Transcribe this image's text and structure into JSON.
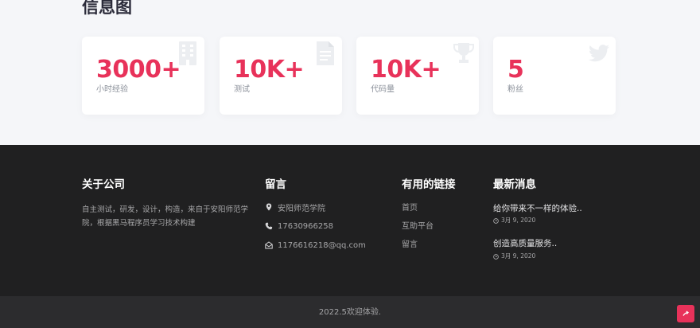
{
  "section": {
    "title": "信息图"
  },
  "stats": [
    {
      "value": "3000+",
      "label": "小时经验",
      "icon": "building-icon"
    },
    {
      "value": "10K+",
      "label": "测试",
      "icon": "document-icon"
    },
    {
      "value": "10K+",
      "label": "代码量",
      "icon": "trophy-icon"
    },
    {
      "value": "5",
      "label": "粉丝",
      "icon": "twitter-icon"
    }
  ],
  "footer": {
    "about": {
      "title": "关于公司",
      "text": "自主测试，研发，设计，构造，来自于安阳师范学院，根据黑马程序员学习技术构建"
    },
    "contact": {
      "title": "留言",
      "items": [
        {
          "icon": "map-marker-icon",
          "text": "安阳师范学院"
        },
        {
          "icon": "phone-icon",
          "text": "17630966258"
        },
        {
          "icon": "envelope-icon",
          "text": "1176616218@qq.com"
        }
      ]
    },
    "links": {
      "title": "有用的链接",
      "items": [
        "首页",
        "互助平台",
        "留言"
      ]
    },
    "news": {
      "title": "最新消息",
      "items": [
        {
          "title": "给你带来不一样的体验..",
          "date": "3月 9, 2020"
        },
        {
          "title": "创造高质量服务..",
          "date": "3月 9, 2020"
        }
      ]
    }
  },
  "bottom": {
    "copyright": "2022.5欢迎体验."
  },
  "colors": {
    "accent": "#e8325a",
    "footer_bg": "#202021",
    "bottom_bg": "#2c2c2e"
  }
}
